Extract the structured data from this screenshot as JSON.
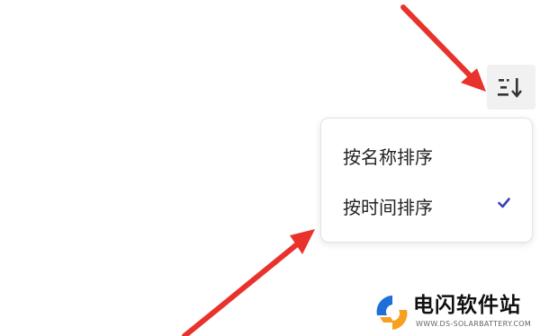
{
  "toolbar": {
    "sort_icon": "sort-lines-arrow-icon"
  },
  "sort_menu": {
    "items": [
      {
        "label": "按名称排序",
        "selected": false
      },
      {
        "label": "按时间排序",
        "selected": true
      }
    ],
    "check_icon": "checkmark-icon",
    "check_color": "#3b3fb3"
  },
  "annotations": {
    "arrow_color": "#e8322b"
  },
  "watermark": {
    "title": "电闪软件站",
    "url": "WWW.DS-SOLARBATTERY.COM",
    "logo_colors": [
      "#1e6fd9",
      "#f5a01e"
    ]
  }
}
